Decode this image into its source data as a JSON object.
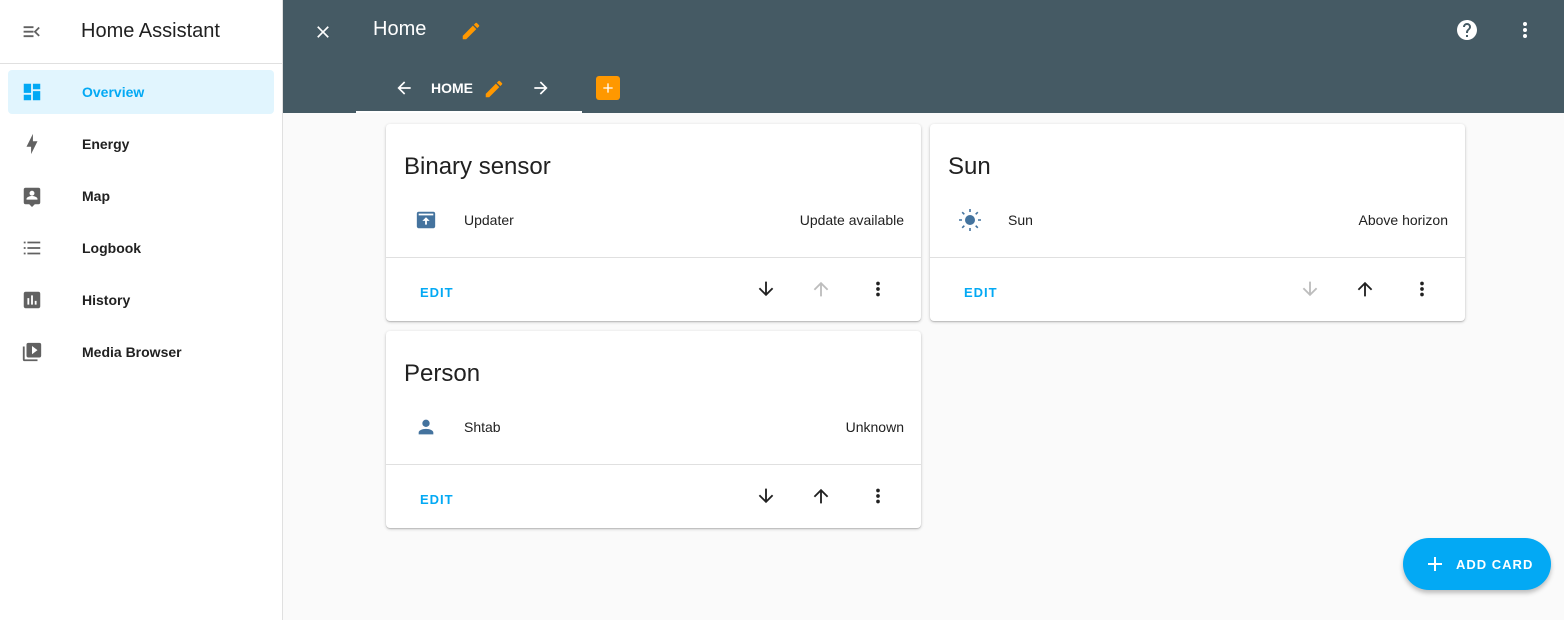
{
  "sidebar": {
    "title": "Home Assistant",
    "items": [
      {
        "label": "Overview",
        "icon": "view-dashboard-icon",
        "active": true
      },
      {
        "label": "Energy",
        "icon": "lightning-bolt-icon"
      },
      {
        "label": "Map",
        "icon": "account-box-icon"
      },
      {
        "label": "Logbook",
        "icon": "format-list-bulleted-icon"
      },
      {
        "label": "History",
        "icon": "chart-box-icon"
      },
      {
        "label": "Media Browser",
        "icon": "play-box-multiple-icon"
      }
    ]
  },
  "header": {
    "title": "Home",
    "tab_label": "HOME"
  },
  "cards": {
    "binary": {
      "title": "Binary sensor",
      "entity_name": "Updater",
      "entity_state": "Update available",
      "edit_label": "EDIT"
    },
    "sun": {
      "title": "Sun",
      "entity_name": "Sun",
      "entity_state": "Above horizon",
      "edit_label": "EDIT"
    },
    "person": {
      "title": "Person",
      "entity_name": "Shtab",
      "entity_state": "Unknown",
      "edit_label": "EDIT"
    }
  },
  "fab": {
    "label": "ADD CARD"
  },
  "colors": {
    "header_bg": "#455a64",
    "accent": "#03a9f4",
    "edit_orange": "#ff9800",
    "entity_icon": "#44739e"
  }
}
